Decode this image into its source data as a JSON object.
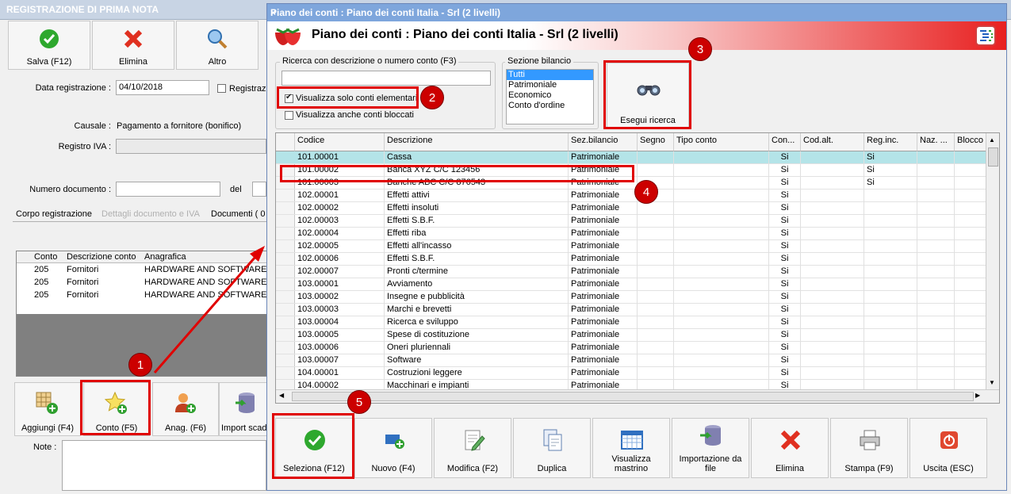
{
  "back": {
    "title": "REGISTRAZIONE DI PRIMA NOTA",
    "toolbar": [
      "Salva (F12)",
      "Elimina",
      "Altro"
    ],
    "date_label": "Data registrazione :",
    "date_value": "04/10/2018",
    "registraz_label": "Registraz",
    "causale_label": "Causale :",
    "causale_value": "Pagamento a fornitore (bonifico)",
    "registro_label": "Registro IVA :",
    "numdoc_label": "Numero documento :",
    "del_label": "del",
    "tabs": [
      "Corpo registrazione",
      "Dettagli documento e IVA",
      "Documenti ( 0"
    ],
    "grid_headers": [
      "Conto",
      "Descrizione conto",
      "Anagrafica"
    ],
    "grid_rows": [
      [
        "205",
        "Fornitori",
        "HARDWARE AND SOFTWARE SRL"
      ],
      [
        "205",
        "Fornitori",
        "HARDWARE AND SOFTWARE SRL"
      ],
      [
        "205",
        "Fornitori",
        "HARDWARE AND SOFTWARE SRL"
      ]
    ],
    "bottom_buttons": [
      "Aggiungi (F4)",
      "Conto (F5)",
      "Anag. (F6)",
      "Import scade"
    ],
    "note_label": "Note :"
  },
  "modal": {
    "title": "Piano dei conti : Piano dei conti Italia - Srl (2 livelli)",
    "header_title": "Piano dei conti : Piano dei conti Italia - Srl (2 livelli)",
    "close": "×",
    "search_group": "Ricerca con descrizione o numero conto (F3)",
    "search_value": "",
    "chk_elementari": "Visualizza solo conti elementari",
    "chk_bloccati": "Visualizza anche conti bloccati",
    "sezione_group": "Sezione bilancio",
    "sezione_options": [
      "Tutti",
      "Patrimoniale",
      "Economico",
      "Conto d'ordine"
    ],
    "search_button": "Esegui ricerca",
    "columns": [
      "Codice",
      "Descrizione",
      "Sez.bilancio",
      "Segno",
      "Tipo conto",
      "Con...",
      "Cod.alt.",
      "Reg.inc.",
      "Naz. ...",
      "Blocco"
    ],
    "rows": [
      [
        "101.00001",
        "Cassa",
        "Patrimoniale",
        "Si",
        "Si"
      ],
      [
        "101.00002",
        "Banca XYZ C/C 123456",
        "Patrimoniale",
        "Si",
        "Si"
      ],
      [
        "101.00003",
        "Banche ABC C/C 876543",
        "Patrimoniale",
        "Si",
        "Si"
      ],
      [
        "102.00001",
        "Effetti attivi",
        "Patrimoniale",
        "Si",
        ""
      ],
      [
        "102.00002",
        "Effetti insoluti",
        "Patrimoniale",
        "Si",
        ""
      ],
      [
        "102.00003",
        "Effetti S.B.F.",
        "Patrimoniale",
        "Si",
        ""
      ],
      [
        "102.00004",
        "Effetti riba",
        "Patrimoniale",
        "Si",
        ""
      ],
      [
        "102.00005",
        "Effetti all'incasso",
        "Patrimoniale",
        "Si",
        ""
      ],
      [
        "102.00006",
        "Effetti S.B.F.",
        "Patrimoniale",
        "Si",
        ""
      ],
      [
        "102.00007",
        "Pronti c/termine",
        "Patrimoniale",
        "Si",
        ""
      ],
      [
        "103.00001",
        "Avviamento",
        "Patrimoniale",
        "Si",
        ""
      ],
      [
        "103.00002",
        "Insegne e pubblicità",
        "Patrimoniale",
        "Si",
        ""
      ],
      [
        "103.00003",
        "Marchi e brevetti",
        "Patrimoniale",
        "Si",
        ""
      ],
      [
        "103.00004",
        "Ricerca e sviluppo",
        "Patrimoniale",
        "Si",
        ""
      ],
      [
        "103.00005",
        "Spese di costituzione",
        "Patrimoniale",
        "Si",
        ""
      ],
      [
        "103.00006",
        "Oneri pluriennali",
        "Patrimoniale",
        "Si",
        ""
      ],
      [
        "103.00007",
        "Software",
        "Patrimoniale",
        "Si",
        ""
      ],
      [
        "104.00001",
        "Costruzioni leggere",
        "Patrimoniale",
        "Si",
        ""
      ],
      [
        "104.00002",
        "Macchinari e impianti",
        "Patrimoniale",
        "Si",
        ""
      ]
    ],
    "buttons": [
      "Seleziona (F12)",
      "Nuovo (F4)",
      "Modifica (F2)",
      "Duplica",
      "Visualizza mastrino",
      "Importazione da file",
      "Elimina",
      "Stampa (F9)",
      "Uscita (ESC)"
    ]
  },
  "annotations": [
    "1",
    "2",
    "3",
    "4",
    "5"
  ],
  "colors": {
    "accent_red": "#e00000",
    "title_blue": "#7ea6dc",
    "selected_row": "#b4e4e8"
  }
}
